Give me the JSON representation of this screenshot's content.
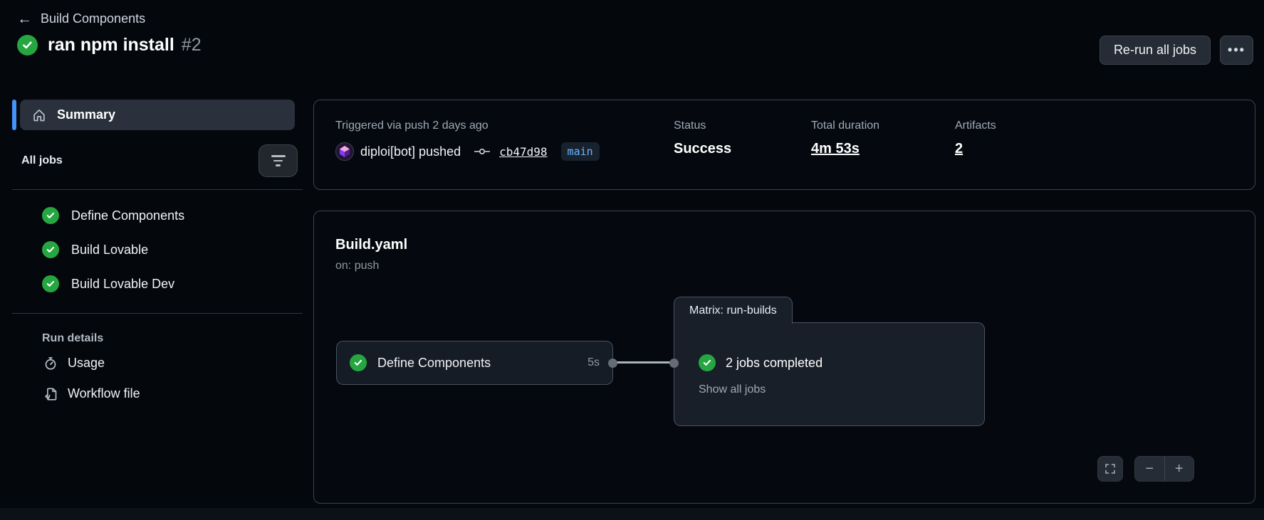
{
  "header": {
    "back_label": "Build Components",
    "run_title": "ran npm install",
    "run_number": "#2",
    "rerun_button_label": "Re-run all jobs",
    "kebab_label": "…"
  },
  "sidebar": {
    "summary_label": "Summary",
    "all_jobs_label": "All jobs",
    "jobs": [
      {
        "label": "Define Components",
        "status": "success"
      },
      {
        "label": "Build Lovable",
        "status": "success"
      },
      {
        "label": "Build Lovable Dev",
        "status": "success"
      }
    ],
    "run_details": {
      "heading": "Run details",
      "items": [
        {
          "label": "Usage",
          "icon": "stopwatch-icon"
        },
        {
          "label": "Workflow file",
          "icon": "code-file-icon"
        }
      ]
    }
  },
  "summary_card": {
    "triggered_text": "Triggered via push 2 days ago",
    "pusher_name": "diploi[bot] pushed",
    "commit_sha": "cb47d98",
    "branch": "main",
    "status_label": "Status",
    "status_value": "Success",
    "duration_label": "Total duration",
    "duration_value": "4m 53s",
    "artifacts_label": "Artifacts",
    "artifacts_value": "2"
  },
  "workflow_card": {
    "title": "Build.yaml",
    "subtitle": "on: push",
    "define_node": {
      "label": "Define Components",
      "duration": "5s",
      "status": "success"
    },
    "matrix_node": {
      "tab_label": "Matrix: run-builds",
      "status_text": "2 jobs completed",
      "link_label": "Show all jobs",
      "status": "success"
    },
    "zoom_out_label": "−",
    "zoom_in_label": "+"
  },
  "colors": {
    "accent_blue": "#4493f8",
    "success_green": "#26a641",
    "branch_badge_text": "#6cb6ff",
    "background": "#04070c",
    "card_border": "#3d444d"
  }
}
